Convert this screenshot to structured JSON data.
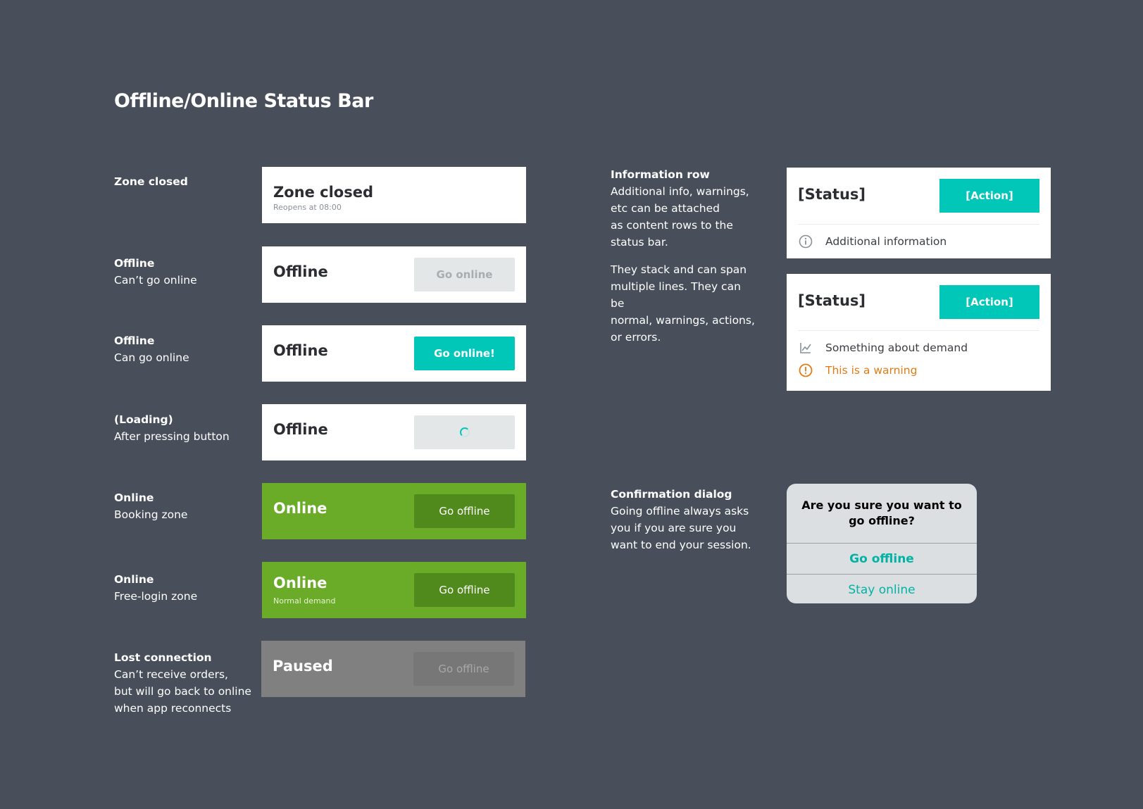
{
  "title": "Offline/Online Status Bar",
  "rows": [
    {
      "label_bold": "Zone closed",
      "label_text": "",
      "status": "Zone closed",
      "sub": "Reopens at 08:00"
    },
    {
      "label_bold": "Offline",
      "label_text": "Can’t go online",
      "status": "Offline",
      "button": "Go online"
    },
    {
      "label_bold": "Offline",
      "label_text": "Can go online",
      "status": "Offline",
      "button": "Go online!"
    },
    {
      "label_bold": "(Loading)",
      "label_text": "After pressing button",
      "status": "Offline"
    },
    {
      "label_bold": "Online",
      "label_text": "Booking zone",
      "status": "Online",
      "button": "Go offline"
    },
    {
      "label_bold": "Online",
      "label_text": "Free-login zone",
      "status": "Online",
      "sub": "Normal demand",
      "button": "Go offline"
    },
    {
      "label_bold": "Lost connection",
      "label_lines": [
        "Can’t receive orders,",
        "but will go back to online",
        "when app reconnects"
      ],
      "status": "Paused",
      "button": "Go offline"
    }
  ],
  "info_row": {
    "heading": "Information row",
    "para1_lines": [
      "Additional info, warnings,",
      "etc can be attached",
      "as content rows to the",
      "status bar."
    ],
    "para2_lines": [
      "They stack and can span",
      "multiple lines. They can be",
      "normal, warnings, actions,",
      "or errors."
    ]
  },
  "card1": {
    "status": "[Status]",
    "action": "[Action]",
    "rows": [
      {
        "icon": "info-icon",
        "text": "Additional information"
      }
    ]
  },
  "card2": {
    "status": "[Status]",
    "action": "[Action]",
    "rows": [
      {
        "icon": "chart-icon",
        "text": "Something about demand"
      },
      {
        "icon": "warning-icon",
        "text": "This is a warning"
      }
    ]
  },
  "confirmation": {
    "heading": "Confirmation dialog",
    "lines": [
      "Going offline always asks",
      "you if you are sure you",
      "want to end your session."
    ],
    "question": "Are you sure you want to go offline?",
    "option1": "Go offline",
    "option2": "Stay online"
  },
  "colors": {
    "background": "#484f5b",
    "accent": "#00c7b8",
    "online": "#6aab27",
    "online_button": "#518a1c",
    "paused": "#808080",
    "warning": "#e07b12"
  }
}
